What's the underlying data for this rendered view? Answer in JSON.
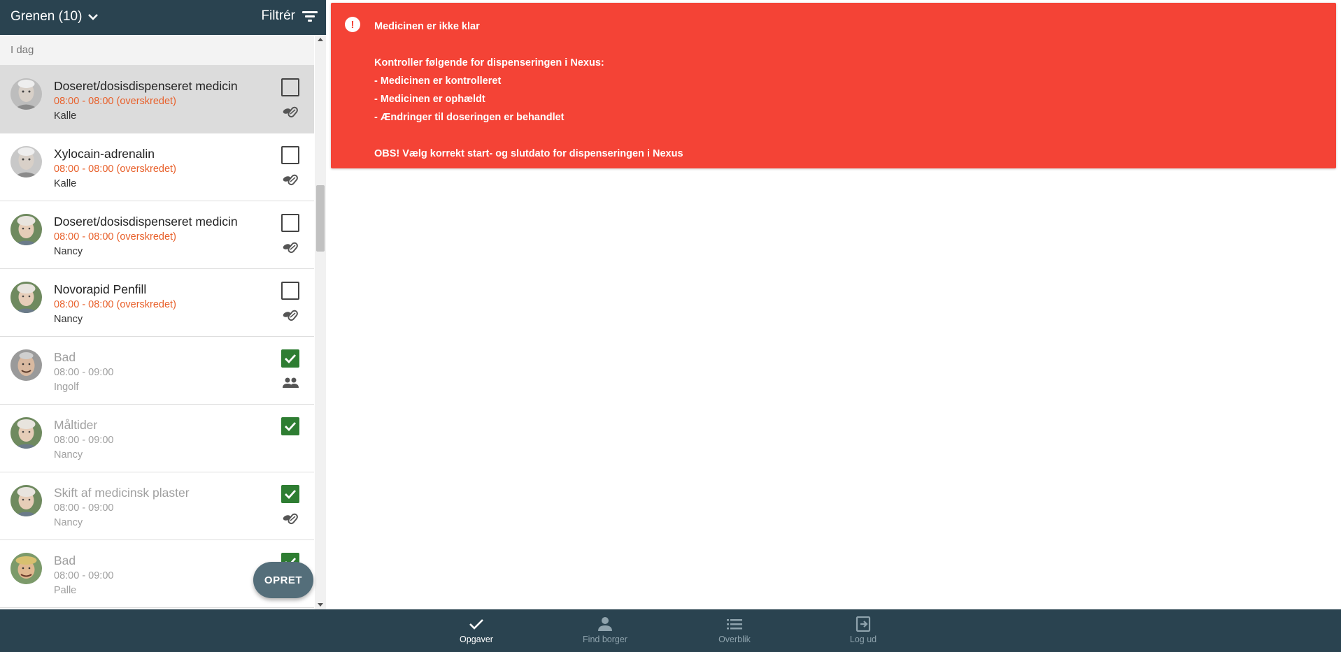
{
  "header": {
    "group_title": "Grenen (10)",
    "filter_label": "Filtrér"
  },
  "list": {
    "section_label": "I dag",
    "tasks": [
      {
        "title": "Doseret/dosisdispenseret medicin",
        "time": "08:00 - 08:00 (overskredet)",
        "person": "Kalle",
        "status": "overdue",
        "checked": false,
        "type_icon": "medicine-icon",
        "selected": true
      },
      {
        "title": "Xylocain-adrenalin",
        "time": "08:00 - 08:00 (overskredet)",
        "person": "Kalle",
        "status": "overdue",
        "checked": false,
        "type_icon": "medicine-icon"
      },
      {
        "title": "Doseret/dosisdispenseret medicin",
        "time": "08:00 - 08:00 (overskredet)",
        "person": "Nancy",
        "status": "overdue",
        "checked": false,
        "type_icon": "medicine-icon"
      },
      {
        "title": "Novorapid Penfill",
        "time": "08:00 - 08:00 (overskredet)",
        "person": "Nancy",
        "status": "overdue",
        "checked": false,
        "type_icon": "medicine-icon"
      },
      {
        "title": "Bad",
        "time": "08:00 - 09:00",
        "person": "Ingolf",
        "status": "done",
        "checked": true,
        "type_icon": "people-icon"
      },
      {
        "title": "Måltider",
        "time": "08:00 - 09:00",
        "person": "Nancy",
        "status": "done",
        "checked": true,
        "type_icon": ""
      },
      {
        "title": "Skift af medicinsk plaster",
        "time": "08:00 - 09:00",
        "person": "Nancy",
        "status": "done",
        "checked": true,
        "type_icon": "medicine-icon"
      },
      {
        "title": "Bad",
        "time": "08:00 - 09:00",
        "person": "Palle",
        "status": "done",
        "checked": true,
        "type_icon": ""
      }
    ],
    "create_button_label": "OPRET"
  },
  "alert": {
    "lines": [
      "Medicinen er ikke klar",
      "",
      "Kontroller følgende for dispenseringen i Nexus:",
      "- Medicinen er kontrolleret",
      "- Medicinen er ophældt",
      "- Ændringer til doseringen er behandlet",
      "",
      "OBS! Vælg korrekt start- og slutdato for dispenseringen i Nexus"
    ],
    "icon": "exclamation-icon",
    "color": "#f44336"
  },
  "bottom_nav": {
    "items": [
      {
        "label": "Opgaver",
        "icon": "check-icon",
        "active": true
      },
      {
        "label": "Find borger",
        "icon": "person-icon",
        "active": false
      },
      {
        "label": "Overblik",
        "icon": "list-icon",
        "active": false
      },
      {
        "label": "Log ud",
        "icon": "logout-icon",
        "active": false
      }
    ]
  },
  "colors": {
    "header_bg": "#2a4350",
    "overdue": "#e8612c",
    "checked": "#2e7d32",
    "fab": "#546e7a"
  }
}
